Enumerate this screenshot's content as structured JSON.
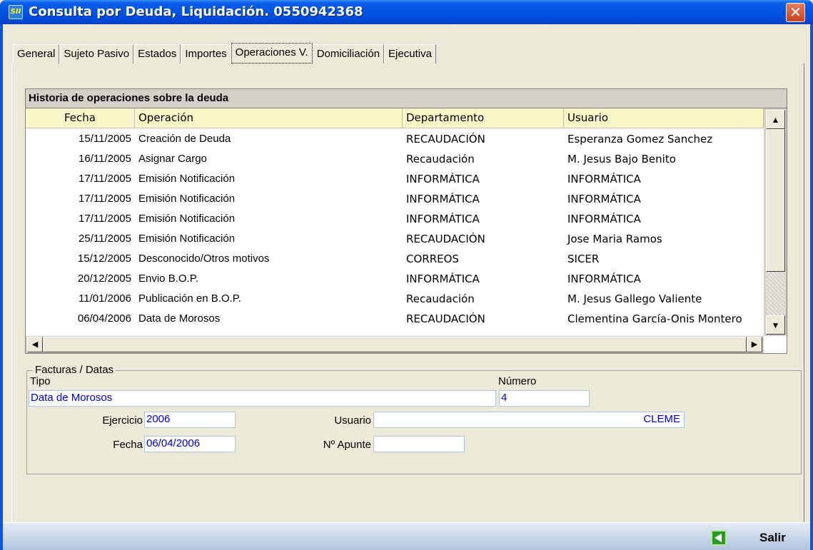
{
  "window": {
    "title": "Consulta por Deuda, Liquidación. 0550942368",
    "icon_text": "SII",
    "close_glyph": "✕"
  },
  "tabs": [
    {
      "label": "General"
    },
    {
      "label": "Sujeto Pasivo"
    },
    {
      "label": "Estados"
    },
    {
      "label": "Importes"
    },
    {
      "label": "Operaciones V.",
      "active": true
    },
    {
      "label": "Domiciliación"
    },
    {
      "label": "Ejecutiva"
    }
  ],
  "grid": {
    "caption": "Historia de operaciones sobre la deuda",
    "columns": [
      "Fecha",
      "Operación",
      "Departamento",
      "Usuario"
    ],
    "rows": [
      [
        "15/11/2005",
        "Creación de Deuda",
        "RECAUDACIÓN",
        "Esperanza Gomez Sanchez"
      ],
      [
        "16/11/2005",
        "Asignar Cargo",
        "Recaudación",
        "M. Jesus Bajo Benito"
      ],
      [
        "17/11/2005",
        "Emisión Notificación",
        "INFORMÁTICA",
        "INFORMÁTICA"
      ],
      [
        "17/11/2005",
        "Emisión Notificación",
        "INFORMÁTICA",
        "INFORMÁTICA"
      ],
      [
        "17/11/2005",
        "Emisión Notificación",
        "INFORMÁTICA",
        "INFORMÁTICA"
      ],
      [
        "25/11/2005",
        "Emisión Notificación",
        "RECAUDACIÓN",
        "Jose Maria Ramos"
      ],
      [
        "15/12/2005",
        "Desconocido/Otros motivos",
        "CORREOS",
        "SICER"
      ],
      [
        "20/12/2005",
        "Envio B.O.P.",
        "INFORMÁTICA",
        "INFORMÁTICA"
      ],
      [
        "11/01/2006",
        "Publicación en B.O.P.",
        "Recaudación",
        "M. Jesus Gallego Valiente"
      ],
      [
        "06/04/2006",
        "Data de Morosos",
        "RECAUDACIÓN",
        "Clementina García-Onis Montero"
      ]
    ]
  },
  "facturas": {
    "legend": "Facturas / Datas",
    "tipo_label": "Tipo",
    "tipo_value": "Data de Morosos",
    "numero_label": "Número",
    "numero_value": "4",
    "ejercicio_label": "Ejercicio",
    "ejercicio_value": "2006",
    "usuario_label": "Usuario",
    "usuario_value": "CLEME",
    "fecha_label": "Fecha",
    "fecha_value": "06/04/2006",
    "apunte_label": "Nº Apunte",
    "apunte_value": ""
  },
  "footer": {
    "salir_label": "Salir"
  }
}
